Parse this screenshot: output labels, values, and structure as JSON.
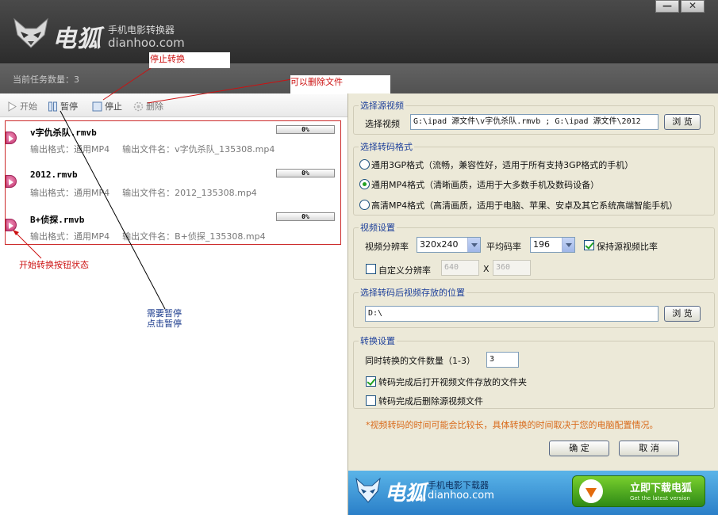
{
  "header": {
    "logo_text": "电狐",
    "subtitle": "手机电影转换器",
    "domain": "dianhoo.com",
    "minimize_label": "—",
    "close_label": "✕"
  },
  "status": {
    "task_count": "当前任务数量：3"
  },
  "toolbar": {
    "start_label": "开始",
    "pause_label": "暂停",
    "stop_label": "停止",
    "delete_label": "删除"
  },
  "tasks": [
    {
      "name": "v字仇杀队.rmvb",
      "progress": "0%",
      "format_label": "输出格式：通用MP4",
      "file_label": "输出文件名：v字仇杀队_135308.mp4"
    },
    {
      "name": "2012.rmvb",
      "progress": "0%",
      "format_label": "输出格式：通用MP4",
      "file_label": "输出文件名：2012_135308.mp4"
    },
    {
      "name": "B+侦探.rmvb",
      "progress": "0%",
      "format_label": "输出格式：通用MP4",
      "file_label": "输出文件名：B+侦探_135308.mp4"
    }
  ],
  "annotations": {
    "stop_convert": "停止转换",
    "can_delete": "可以删除文件",
    "start_state": "开始转换按钮状态",
    "need_pause_1": "需要暂停",
    "need_pause_2": "点击暂停"
  },
  "source": {
    "title": "选择源视频",
    "label": "选择视频",
    "value": "G:\\ipad 源文件\\v字仇杀队.rmvb ; G:\\ipad 源文件\\2012",
    "browse": "浏 览"
  },
  "format": {
    "title": "选择转码格式",
    "options": [
      {
        "label": "通用3GP格式（流畅，兼容性好，适用于所有支持3GP格式的手机）",
        "selected": false
      },
      {
        "label": "通用MP4格式（清晰画质，适用于大多数手机及数码设备）",
        "selected": true
      },
      {
        "label": "高清MP4格式（高清画质，适用于电脑、苹果、安卓及其它系统高端智能手机）",
        "selected": false
      }
    ]
  },
  "video": {
    "title": "视频设置",
    "resolution_label": "视频分辨率",
    "resolution_value": "320x240",
    "bitrate_label": "平均码率",
    "bitrate_value": "196",
    "keep_ratio_label": "保持源视频比率",
    "keep_ratio_checked": true,
    "custom_label": "自定义分辨率",
    "custom_checked": false,
    "custom_width": "640",
    "x_label": "X",
    "custom_height": "360"
  },
  "output": {
    "title": "选择转码后视频存放的位置",
    "path": "D:\\",
    "browse": "浏 览"
  },
  "convert": {
    "title": "转换设置",
    "concurrent_label": "同时转换的文件数量（1-3）",
    "concurrent_value": "3",
    "open_folder_label": "转码完成后打开视频文件存放的文件夹",
    "open_folder_checked": true,
    "delete_source_label": "转码完成后删除源视频文件",
    "delete_source_checked": false
  },
  "note": "*视频转码的时间可能会比较长，具体转换的时间取决于您的电脑配置情况。",
  "buttons": {
    "ok": "确 定",
    "cancel": "取 消"
  },
  "banner": {
    "logo_text": "电狐",
    "subtitle": "手机电影下载器",
    "domain": "dianhoo.com",
    "download_label": "立即下载电狐",
    "download_sub": "Get the latest version"
  },
  "colors": {
    "annotation_red": "#cc1111",
    "annotation_blue": "#1a3a8c",
    "group_title_blue": "#1c3f9a",
    "note_orange": "#d96a1a",
    "panel_bg": "#ece9d8"
  }
}
